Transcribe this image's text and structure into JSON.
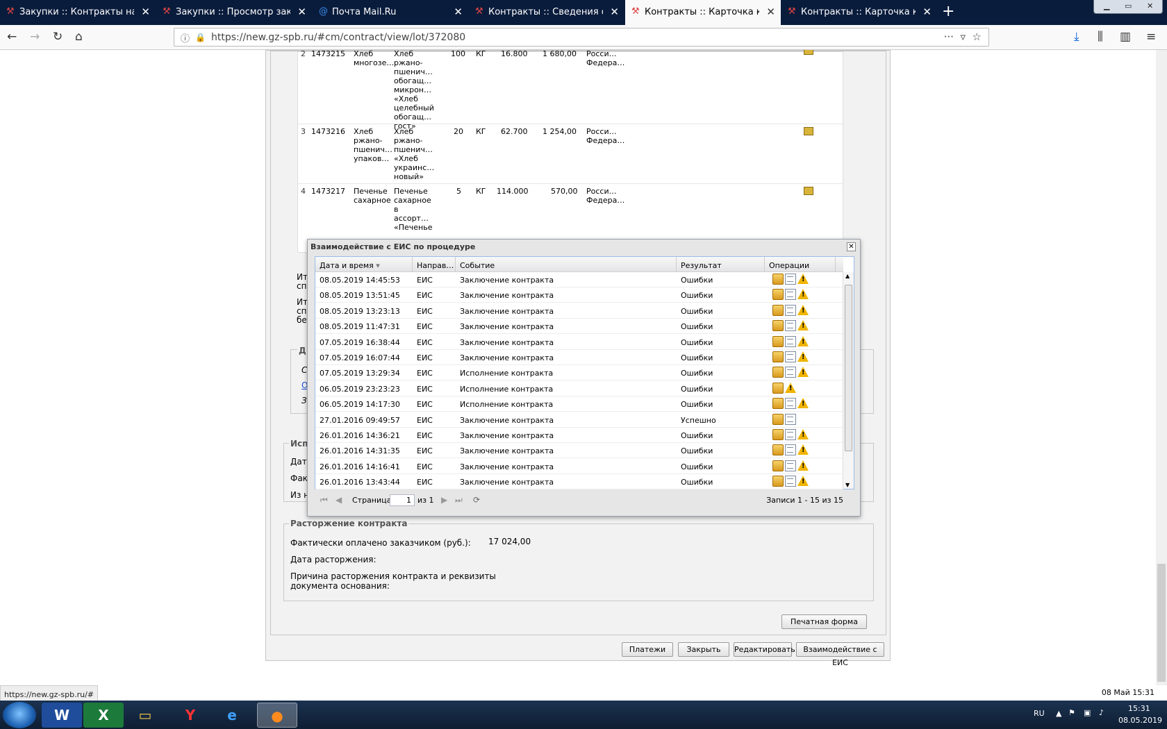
{
  "browser": {
    "tabs": [
      {
        "title": "Закупки :: Контракты на этапе"
      },
      {
        "title": "Закупки :: Просмотр закупки"
      },
      {
        "title": "Почта Mail.Ru"
      },
      {
        "title": "Контракты :: Сведения об исп"
      },
      {
        "title": "Контракты :: Карточка контра"
      },
      {
        "title": "Контракты :: Карточка контра"
      }
    ],
    "url": "https://new.gz-spb.ru/#cm/contract/view/lot/372080"
  },
  "items": [
    {
      "no": "2",
      "code": "1473215",
      "name": "Хлеб многозе…",
      "desc": "Хлеб ржано-пшенич… обогащ… микрон… «Хлеб целебный обогащ… гост»",
      "qty": "100",
      "unit": "КГ",
      "price": "16.800",
      "sum": "1 680,00",
      "country": "Росси… Федера…"
    },
    {
      "no": "3",
      "code": "1473216",
      "name": "Хлеб ржано-пшенич… упаков…",
      "desc": "Хлеб ржано-пшенич… «Хлеб украинс… новый»",
      "qty": "20",
      "unit": "КГ",
      "price": "62.700",
      "sum": "1 254,00",
      "country": "Росси… Федера…"
    },
    {
      "no": "4",
      "code": "1473217",
      "name": "Печенье сахарное",
      "desc": "Печенье сахарное в ассорт… «Печенье",
      "qty": "5",
      "unit": "КГ",
      "price": "114.000",
      "sum": "570,00",
      "country": "Росси… Федера…"
    }
  ],
  "page": {
    "left_labels": [
      "Ит",
      "сп",
      "Ит",
      "сп",
      "бе",
      "Д",
      "С",
      "О",
      "З",
      "Исп",
      "Дата",
      "Факт",
      "Из н"
    ],
    "termination": {
      "legend": "Расторжение контракта",
      "paid_label": "Фактически оплачено заказчиком (руб.):",
      "paid_value": "17 024,00",
      "date_label": "Дата расторжения:",
      "reason_label_1": "Причина расторжения контракта и реквизиты",
      "reason_label_2": "документа основания:"
    },
    "print_button": "Печатная форма",
    "buttons": {
      "payments": "Платежи",
      "close": "Закрыть",
      "edit": "Редактировать",
      "eis": "Взаимодействие с ЕИС"
    }
  },
  "modal": {
    "title": "Взаимодействие с ЕИС по процедуре",
    "columns": {
      "date": "Дата и время",
      "dir": "Направ…",
      "event": "Событие",
      "result": "Результат",
      "ops": "Операции"
    },
    "rows": [
      {
        "date": "08.05.2019 14:45:53",
        "dir": "ЕИС",
        "event": "Заключение контракта",
        "result": "Ошибки",
        "icons": [
          "box",
          "doc",
          "warn"
        ]
      },
      {
        "date": "08.05.2019 13:51:45",
        "dir": "ЕИС",
        "event": "Заключение контракта",
        "result": "Ошибки",
        "icons": [
          "box",
          "doc",
          "warn"
        ]
      },
      {
        "date": "08.05.2019 13:23:13",
        "dir": "ЕИС",
        "event": "Заключение контракта",
        "result": "Ошибки",
        "icons": [
          "box",
          "doc",
          "warn"
        ]
      },
      {
        "date": "08.05.2019 11:47:31",
        "dir": "ЕИС",
        "event": "Заключение контракта",
        "result": "Ошибки",
        "icons": [
          "box",
          "doc",
          "warn"
        ]
      },
      {
        "date": "07.05.2019 16:38:44",
        "dir": "ЕИС",
        "event": "Заключение контракта",
        "result": "Ошибки",
        "icons": [
          "box",
          "doc",
          "warn"
        ]
      },
      {
        "date": "07.05.2019 16:07:44",
        "dir": "ЕИС",
        "event": "Заключение контракта",
        "result": "Ошибки",
        "icons": [
          "box",
          "doc",
          "warn"
        ]
      },
      {
        "date": "07.05.2019 13:29:34",
        "dir": "ЕИС",
        "event": "Исполнение контракта",
        "result": "Ошибки",
        "icons": [
          "box",
          "doc",
          "warn"
        ]
      },
      {
        "date": "06.05.2019 23:23:23",
        "dir": "ЕИС",
        "event": "Исполнение контракта",
        "result": "Ошибки",
        "icons": [
          "box",
          "warn"
        ]
      },
      {
        "date": "06.05.2019 14:17:30",
        "dir": "ЕИС",
        "event": "Исполнение контракта",
        "result": "Ошибки",
        "icons": [
          "box",
          "doc",
          "warn"
        ]
      },
      {
        "date": "27.01.2016 09:49:57",
        "dir": "ЕИС",
        "event": "Заключение контракта",
        "result": "Успешно",
        "icons": [
          "box",
          "doc"
        ]
      },
      {
        "date": "26.01.2016 14:36:21",
        "dir": "ЕИС",
        "event": "Заключение контракта",
        "result": "Ошибки",
        "icons": [
          "box",
          "doc",
          "warn"
        ]
      },
      {
        "date": "26.01.2016 14:31:35",
        "dir": "ЕИС",
        "event": "Заключение контракта",
        "result": "Ошибки",
        "icons": [
          "box",
          "doc",
          "warn"
        ]
      },
      {
        "date": "26.01.2016 14:16:41",
        "dir": "ЕИС",
        "event": "Заключение контракта",
        "result": "Ошибки",
        "icons": [
          "box",
          "doc",
          "warn"
        ]
      },
      {
        "date": "26.01.2016 13:43:44",
        "dir": "ЕИС",
        "event": "Заключение контракта",
        "result": "Ошибки",
        "icons": [
          "box",
          "doc",
          "warn"
        ]
      }
    ],
    "pager": {
      "page_label": "Страница",
      "page_value": "1",
      "of_label": "из 1",
      "records": "Записи 1 - 15 из 15"
    }
  },
  "status": {
    "url": "https://new.gz-spb.ru/#",
    "date": "08 Май 15:31"
  },
  "taskbar": {
    "lang": "RU",
    "time": "15:31",
    "date": "08.05.2019"
  }
}
